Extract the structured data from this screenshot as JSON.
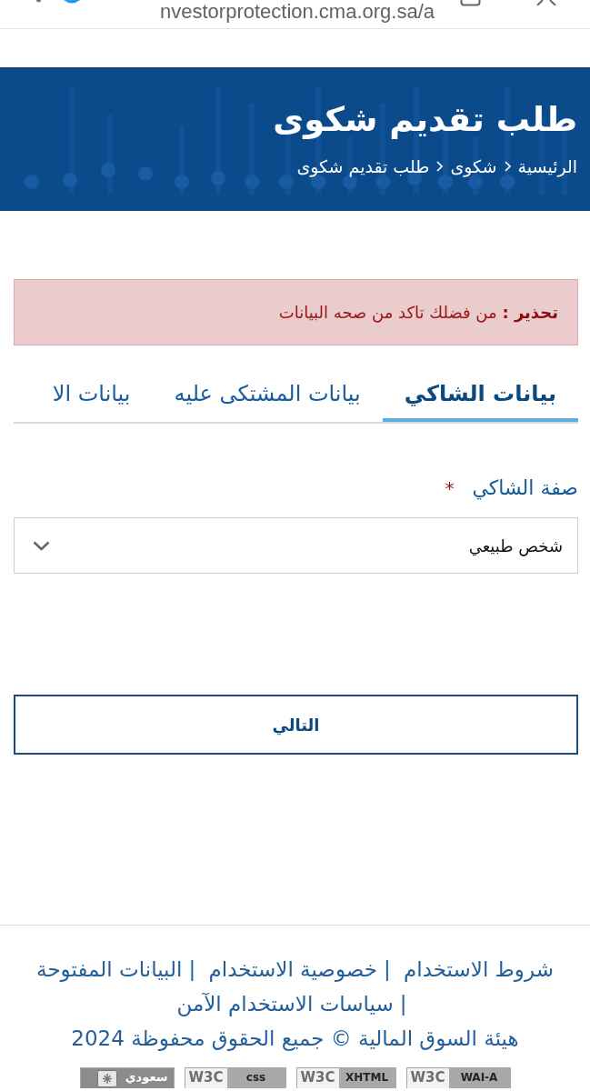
{
  "browser": {
    "url": "nvestorprotection.cma.org.sa/a"
  },
  "banner": {
    "title": "طلب تقديم شكوى",
    "breadcrumb": [
      "الرئيسية",
      "شكوى",
      "طلب تقديم شكوى"
    ]
  },
  "alert": {
    "text": "**تحذير :** من فضلك تاكد من صحه البيانات"
  },
  "tabs": [
    {
      "label": "بيانات الشاكي",
      "selected": true
    },
    {
      "label": "بيانات المشتكى عليه",
      "selected": false
    },
    {
      "label": "بيانات الا",
      "selected": false
    }
  ],
  "form": {
    "field": {
      "label": "صفة الشاكي",
      "required_mark": "*",
      "value": "شخص طبيعي"
    },
    "next_button": "التالي"
  },
  "footer": {
    "links": [
      "شروط الاستخدام",
      "خصوصية الاستخدام",
      "البيانات المفتوحة",
      "سياسات الاستخدام الآمن"
    ],
    "separator": "|",
    "copyright": "هيئة السوق المالية © جميع الحقوق محفوظة 2024",
    "badges": [
      {
        "kind": "w3c",
        "logo": "W3C",
        "label": "WAI-A"
      },
      {
        "kind": "w3c",
        "logo": "W3C",
        "label": "XHTML"
      },
      {
        "kind": "w3c",
        "logo": "W3C",
        "label": "css"
      },
      {
        "kind": "emblem",
        "label": "سعودي"
      }
    ]
  }
}
